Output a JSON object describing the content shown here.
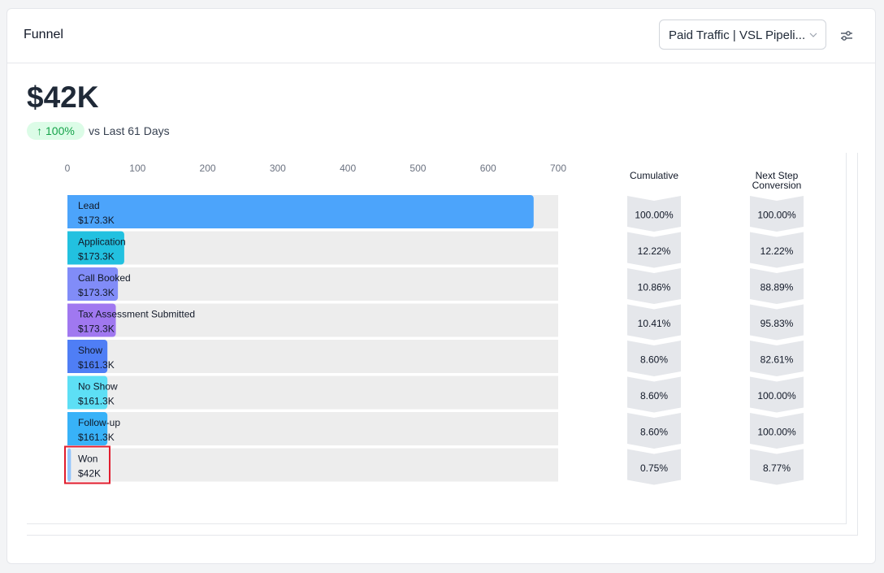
{
  "header": {
    "title": "Funnel",
    "pipeline_value": "Paid Traffic | VSL Pipeline",
    "pipeline_display": "Paid Traffic | VSL Pipeli..."
  },
  "summary": {
    "value": "$42K",
    "change": "100%",
    "compare_text": "vs Last 61 Days"
  },
  "colors": {
    "accent_green": "#16a34a",
    "badge_bg": "#dcfce7",
    "track": "#ededed",
    "chevron": "#e5e7eb"
  },
  "chart_data": {
    "type": "bar",
    "orientation": "horizontal",
    "xlim": [
      0,
      700
    ],
    "xticks": [
      "0",
      "100",
      "200",
      "300",
      "400",
      "500",
      "600",
      "700"
    ],
    "grid": false,
    "categories": [
      "Lead",
      "Application",
      "Call Booked",
      "Tax Assessment Submitted",
      "Show",
      "No Show",
      "Follow-up",
      "Won"
    ],
    "values": [
      665,
      81,
      72,
      69,
      57,
      57,
      57,
      5
    ],
    "value_labels": [
      "$173.3K",
      "$173.3K",
      "$173.3K",
      "$173.3K",
      "$161.3K",
      "$161.3K",
      "$161.3K",
      "$42K"
    ],
    "bar_colors": [
      "#4ca4fb",
      "#22c1e0",
      "#818cf8",
      "#a078f0",
      "#4f7ef5",
      "#5ddff5",
      "#38b2f8",
      "#93c5fd"
    ],
    "highlighted": "Won",
    "cumulative_header": "Cumulative",
    "cumulative": [
      "100.00%",
      "12.22%",
      "10.86%",
      "10.41%",
      "8.60%",
      "8.60%",
      "8.60%",
      "0.75%"
    ],
    "conversion_header": [
      "Next Step",
      "Conversion"
    ],
    "next_step_conversion": [
      "100.00%",
      "12.22%",
      "88.89%",
      "95.83%",
      "82.61%",
      "100.00%",
      "100.00%",
      "8.77%"
    ]
  }
}
